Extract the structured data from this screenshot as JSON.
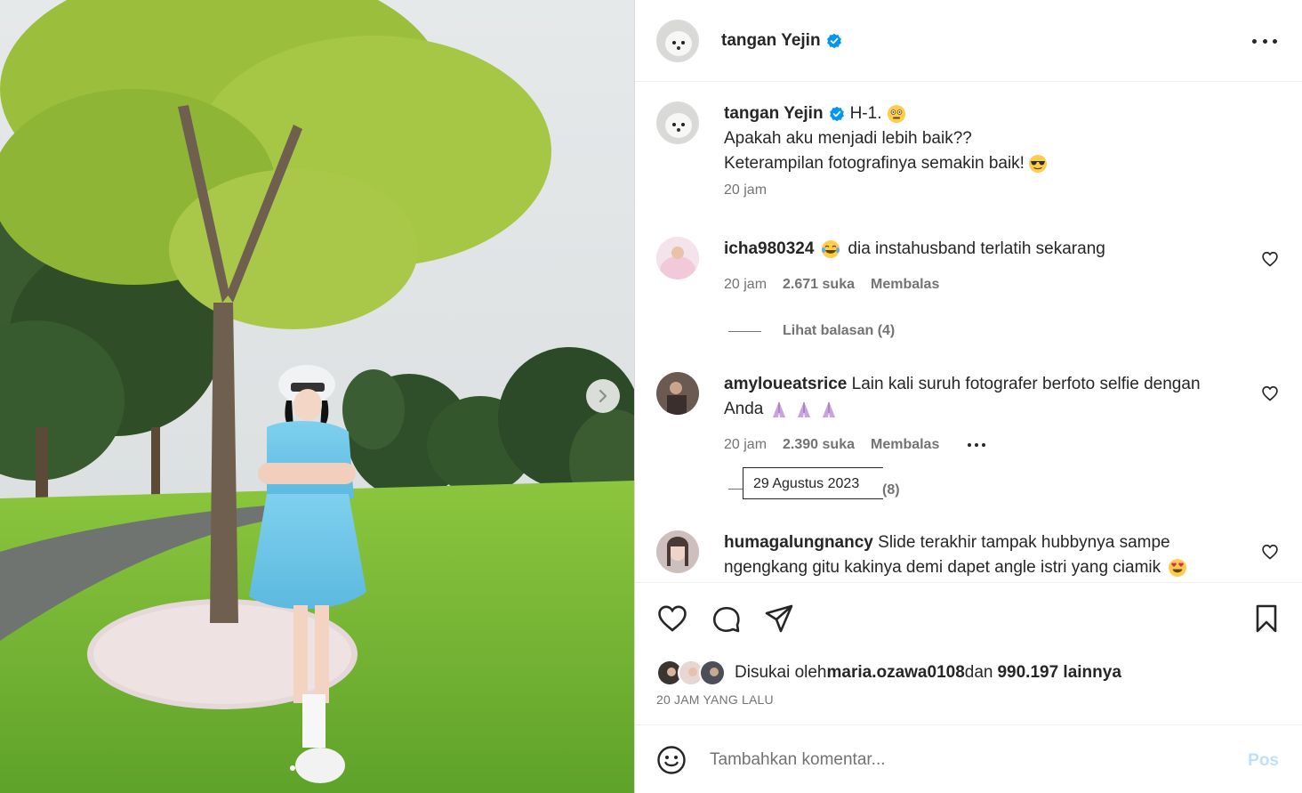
{
  "post": {
    "author": "tangan Yejin",
    "caption_lines": [
      "H-1.",
      "Apakah aku menjadi lebih baik??",
      "Keterampilan fotografinya semakin baik!"
    ],
    "caption_time": "20 jam"
  },
  "comments": [
    {
      "user": "icha980324",
      "text": "dia instahusband terlatih sekarang",
      "time": "20 jam",
      "likes": "2.671 suka",
      "reply_label": "Membalas",
      "view_replies": "Lihat balasan (4)"
    },
    {
      "user": "amyloueatsrice",
      "text_line1": "Lain kali suruh fotografer berfoto selfie dengan",
      "text_line2": "Anda",
      "time": "20 jam",
      "likes": "2.390 suka",
      "reply_label": "Membalas",
      "tooltip_date": "29 Agustus 2023",
      "reply_count": "(8)"
    },
    {
      "user": "humagalungnancy",
      "text_line1": "Slide terakhir tampak hubbynya sampe",
      "text_line2": "ngengkang gitu kakinya demi dapet angle istri yang ciamik"
    }
  ],
  "likes": {
    "prefix": "Disukai oleh",
    "user": "maria.ozawa0108",
    "middle": "dan",
    "others": "990.197 lainnya"
  },
  "time_ago": "20 JAM YANG LALU",
  "composer": {
    "placeholder": "Tambahkan komentar...",
    "post_label": "Pos"
  },
  "icons": [
    "more-icon",
    "verified-icon",
    "heart-icon",
    "comment-icon",
    "share-icon",
    "bookmark-icon",
    "emoji-icon",
    "chevron-right-icon"
  ],
  "colors": {
    "verified": "#0095f6",
    "post_disabled": "#c0dffd",
    "secondary_text": "#737373"
  }
}
